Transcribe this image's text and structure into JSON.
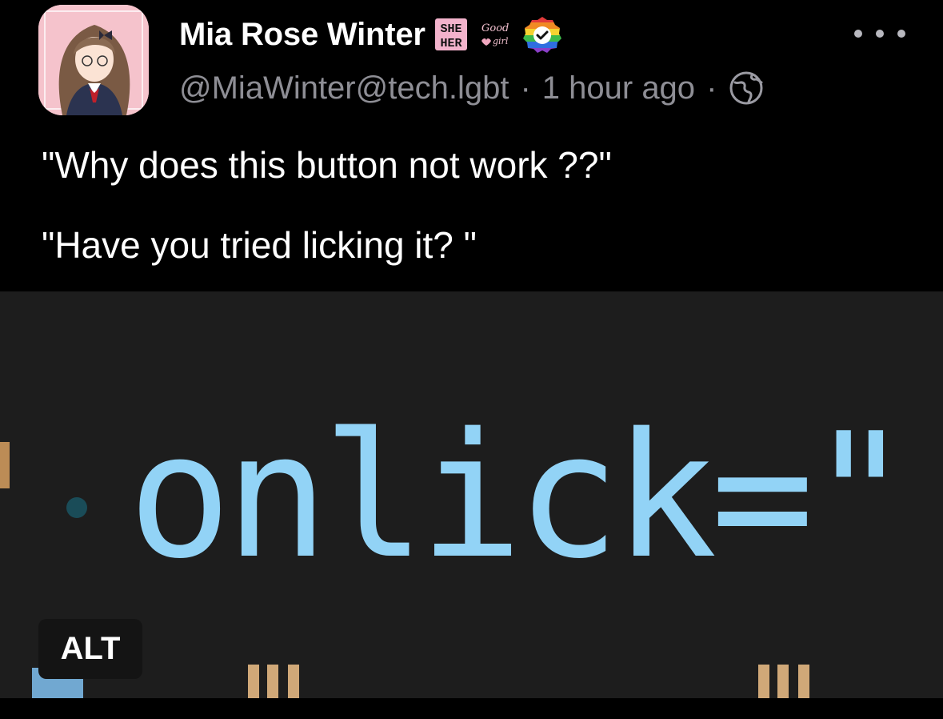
{
  "post": {
    "author": {
      "display_name": "Mia Rose Winter",
      "handle": "@MiaWinter@tech.lgbt",
      "emojis": [
        "she-her-badge",
        "good-girl-badge",
        "rainbow-verified-badge"
      ]
    },
    "timestamp": "1 hour ago",
    "separator": "·",
    "visibility_icon": "globe-icon",
    "more_icon": "ellipsis-icon",
    "paragraphs": [
      "\"Why does this button not work ??\"",
      "\"Have you tried licking it? \""
    ],
    "media": {
      "code_text": "onlick=\"",
      "alt_label": "ALT"
    }
  }
}
